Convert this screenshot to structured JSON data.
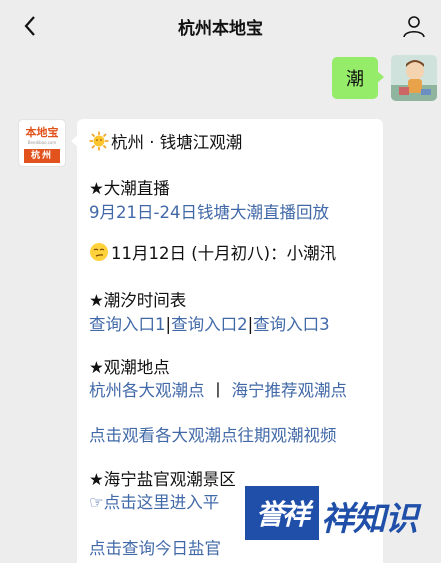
{
  "header": {
    "title": "杭州本地宝",
    "back_icon": "chevron-left-icon",
    "user_icon": "person-icon"
  },
  "sent_message": {
    "text": "潮"
  },
  "bot": {
    "avatar_brand": "本地宝",
    "avatar_domain": "Bendibao.com",
    "avatar_city": "杭州"
  },
  "reply": {
    "heading": "杭州 · 钱塘江观潮",
    "live_title": "★大潮直播",
    "live_link": "9月21日-24日钱塘大潮直播回放",
    "date_line": "11月12日 (十月初八)：小潮汛",
    "tide_title": "★潮汐时间表",
    "tide_links": [
      "查询入口1",
      "查询入口2",
      "查询入口3"
    ],
    "tide_sep": "|",
    "spots_title": "★观潮地点",
    "spots_link_1": "杭州各大观潮点",
    "spots_sep": "丨",
    "spots_link_2": "海宁推荐观潮点",
    "video_link": "点击观看各大观潮点往期观潮视频",
    "haining_title": "★海宁盐官观潮景区",
    "haining_link": "☞点击这里进入平",
    "query_link": "点击查询今日盐官"
  },
  "watermark": {
    "box_text": "誉祥",
    "text": "祥知识"
  },
  "colors": {
    "background": "#ededed",
    "sent_bubble": "#95ec69",
    "link": "#4169a8",
    "brand": "#e2521c",
    "watermark": "#1f4fa8"
  }
}
